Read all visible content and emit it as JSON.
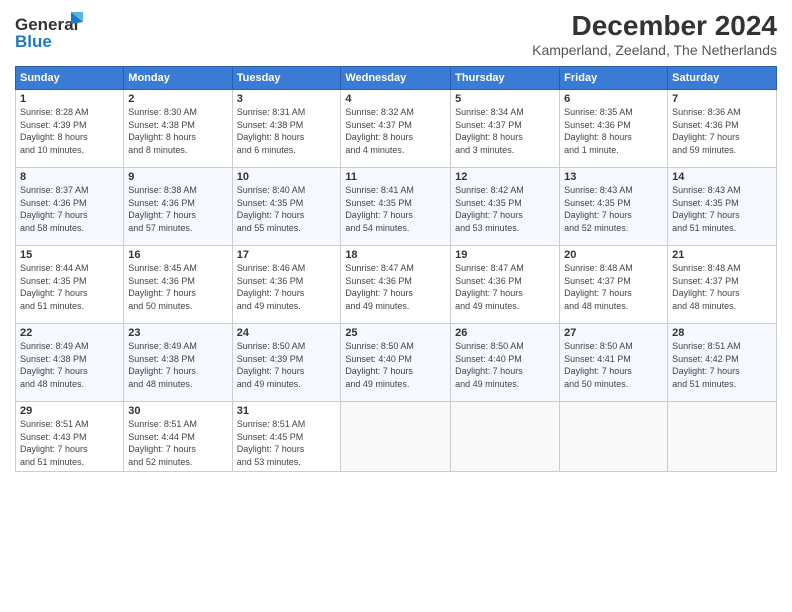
{
  "header": {
    "logo_general": "General",
    "logo_blue": "Blue",
    "main_title": "December 2024",
    "subtitle": "Kamperland, Zeeland, The Netherlands"
  },
  "columns": [
    "Sunday",
    "Monday",
    "Tuesday",
    "Wednesday",
    "Thursday",
    "Friday",
    "Saturday"
  ],
  "weeks": [
    [
      {
        "day": "1",
        "info": "Sunrise: 8:28 AM\nSunset: 4:39 PM\nDaylight: 8 hours\nand 10 minutes."
      },
      {
        "day": "2",
        "info": "Sunrise: 8:30 AM\nSunset: 4:38 PM\nDaylight: 8 hours\nand 8 minutes."
      },
      {
        "day": "3",
        "info": "Sunrise: 8:31 AM\nSunset: 4:38 PM\nDaylight: 8 hours\nand 6 minutes."
      },
      {
        "day": "4",
        "info": "Sunrise: 8:32 AM\nSunset: 4:37 PM\nDaylight: 8 hours\nand 4 minutes."
      },
      {
        "day": "5",
        "info": "Sunrise: 8:34 AM\nSunset: 4:37 PM\nDaylight: 8 hours\nand 3 minutes."
      },
      {
        "day": "6",
        "info": "Sunrise: 8:35 AM\nSunset: 4:36 PM\nDaylight: 8 hours\nand 1 minute."
      },
      {
        "day": "7",
        "info": "Sunrise: 8:36 AM\nSunset: 4:36 PM\nDaylight: 7 hours\nand 59 minutes."
      }
    ],
    [
      {
        "day": "8",
        "info": "Sunrise: 8:37 AM\nSunset: 4:36 PM\nDaylight: 7 hours\nand 58 minutes."
      },
      {
        "day": "9",
        "info": "Sunrise: 8:38 AM\nSunset: 4:36 PM\nDaylight: 7 hours\nand 57 minutes."
      },
      {
        "day": "10",
        "info": "Sunrise: 8:40 AM\nSunset: 4:35 PM\nDaylight: 7 hours\nand 55 minutes."
      },
      {
        "day": "11",
        "info": "Sunrise: 8:41 AM\nSunset: 4:35 PM\nDaylight: 7 hours\nand 54 minutes."
      },
      {
        "day": "12",
        "info": "Sunrise: 8:42 AM\nSunset: 4:35 PM\nDaylight: 7 hours\nand 53 minutes."
      },
      {
        "day": "13",
        "info": "Sunrise: 8:43 AM\nSunset: 4:35 PM\nDaylight: 7 hours\nand 52 minutes."
      },
      {
        "day": "14",
        "info": "Sunrise: 8:43 AM\nSunset: 4:35 PM\nDaylight: 7 hours\nand 51 minutes."
      }
    ],
    [
      {
        "day": "15",
        "info": "Sunrise: 8:44 AM\nSunset: 4:35 PM\nDaylight: 7 hours\nand 51 minutes."
      },
      {
        "day": "16",
        "info": "Sunrise: 8:45 AM\nSunset: 4:36 PM\nDaylight: 7 hours\nand 50 minutes."
      },
      {
        "day": "17",
        "info": "Sunrise: 8:46 AM\nSunset: 4:36 PM\nDaylight: 7 hours\nand 49 minutes."
      },
      {
        "day": "18",
        "info": "Sunrise: 8:47 AM\nSunset: 4:36 PM\nDaylight: 7 hours\nand 49 minutes."
      },
      {
        "day": "19",
        "info": "Sunrise: 8:47 AM\nSunset: 4:36 PM\nDaylight: 7 hours\nand 49 minutes."
      },
      {
        "day": "20",
        "info": "Sunrise: 8:48 AM\nSunset: 4:37 PM\nDaylight: 7 hours\nand 48 minutes."
      },
      {
        "day": "21",
        "info": "Sunrise: 8:48 AM\nSunset: 4:37 PM\nDaylight: 7 hours\nand 48 minutes."
      }
    ],
    [
      {
        "day": "22",
        "info": "Sunrise: 8:49 AM\nSunset: 4:38 PM\nDaylight: 7 hours\nand 48 minutes."
      },
      {
        "day": "23",
        "info": "Sunrise: 8:49 AM\nSunset: 4:38 PM\nDaylight: 7 hours\nand 48 minutes."
      },
      {
        "day": "24",
        "info": "Sunrise: 8:50 AM\nSunset: 4:39 PM\nDaylight: 7 hours\nand 49 minutes."
      },
      {
        "day": "25",
        "info": "Sunrise: 8:50 AM\nSunset: 4:40 PM\nDaylight: 7 hours\nand 49 minutes."
      },
      {
        "day": "26",
        "info": "Sunrise: 8:50 AM\nSunset: 4:40 PM\nDaylight: 7 hours\nand 49 minutes."
      },
      {
        "day": "27",
        "info": "Sunrise: 8:50 AM\nSunset: 4:41 PM\nDaylight: 7 hours\nand 50 minutes."
      },
      {
        "day": "28",
        "info": "Sunrise: 8:51 AM\nSunset: 4:42 PM\nDaylight: 7 hours\nand 51 minutes."
      }
    ],
    [
      {
        "day": "29",
        "info": "Sunrise: 8:51 AM\nSunset: 4:43 PM\nDaylight: 7 hours\nand 51 minutes."
      },
      {
        "day": "30",
        "info": "Sunrise: 8:51 AM\nSunset: 4:44 PM\nDaylight: 7 hours\nand 52 minutes."
      },
      {
        "day": "31",
        "info": "Sunrise: 8:51 AM\nSunset: 4:45 PM\nDaylight: 7 hours\nand 53 minutes."
      },
      {
        "day": "",
        "info": ""
      },
      {
        "day": "",
        "info": ""
      },
      {
        "day": "",
        "info": ""
      },
      {
        "day": "",
        "info": ""
      }
    ]
  ]
}
